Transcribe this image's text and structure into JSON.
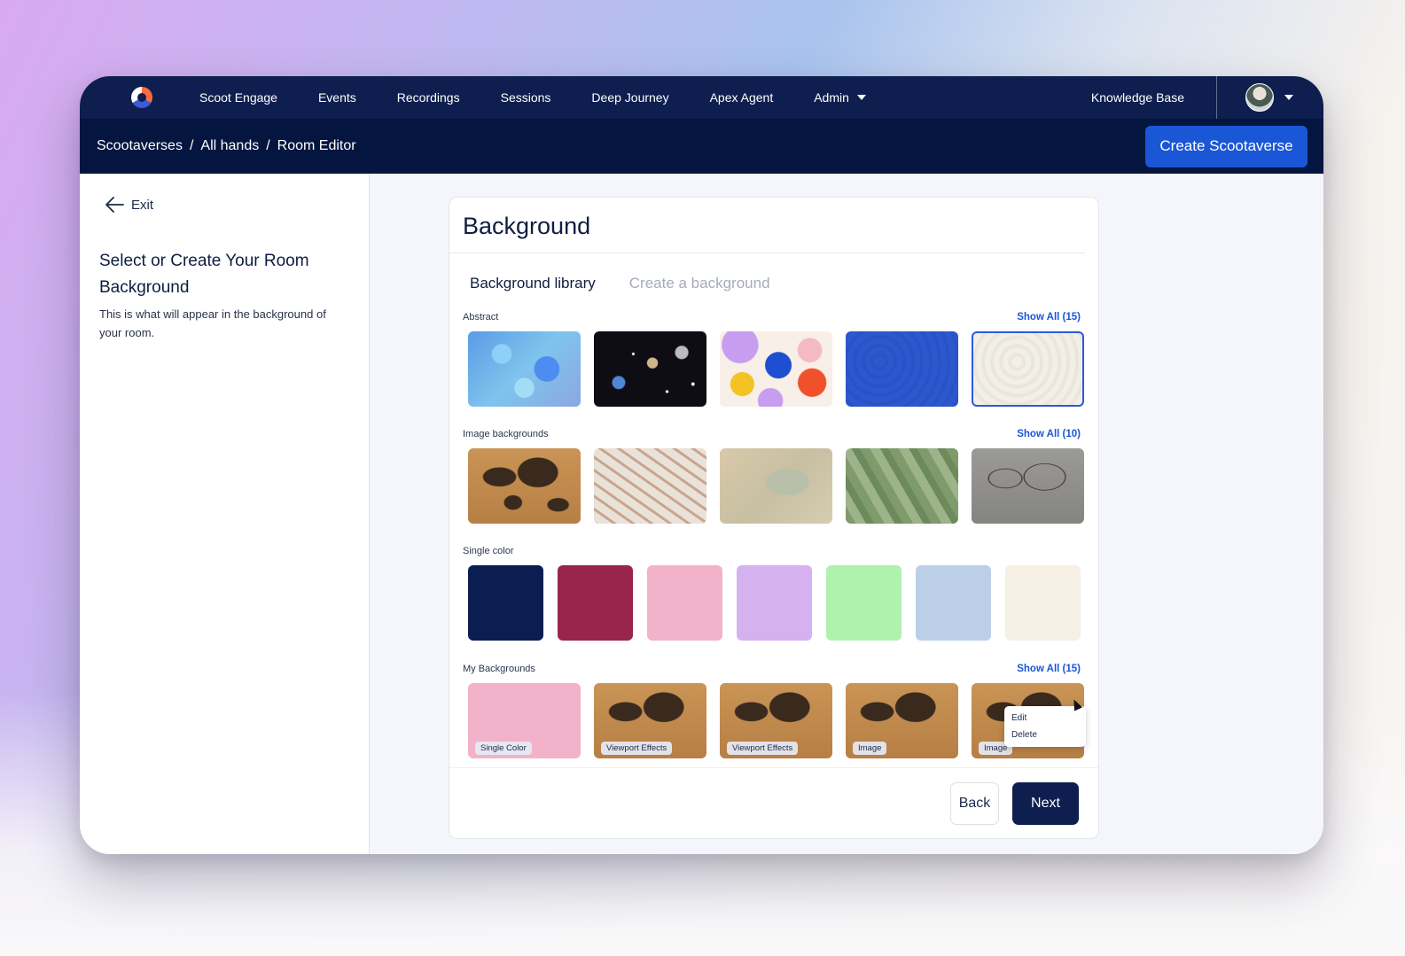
{
  "nav": {
    "items": [
      "Scoot Engage",
      "Events",
      "Recordings",
      "Sessions",
      "Deep Journey",
      "Apex Agent"
    ],
    "admin": "Admin",
    "knowledge_base": "Knowledge Base"
  },
  "breadcrumb": [
    "Scootaverses",
    "/",
    "All hands",
    "/",
    "Room Editor"
  ],
  "create_button": "Create Scootaverse",
  "left": {
    "exit": "Exit",
    "title": "Select or Create Your Room Background",
    "description": "This is what will appear in the background of your room."
  },
  "card": {
    "title": "Background",
    "tabs": [
      "Background library",
      "Create a background"
    ],
    "sections": {
      "abstract": {
        "label": "Abstract",
        "show_all": "Show All (15)"
      },
      "images": {
        "label": "Image backgrounds",
        "show_all": "Show All (10)"
      },
      "single": {
        "label": "Single color"
      },
      "mine": {
        "label": "My Backgrounds",
        "show_all": "Show All (15)"
      }
    },
    "single_colors": [
      "#0c1d52",
      "#99254c",
      "#f2b2c9",
      "#d5b1ef",
      "#aef2ad",
      "#bccfe8",
      "#f5efe4"
    ],
    "my_tags": [
      "Single Color",
      "Viewport Effects",
      "Viewport Effects",
      "Image",
      "Image"
    ],
    "menu": {
      "edit": "Edit",
      "delete": "Delete"
    },
    "back": "Back",
    "next": "Next"
  }
}
